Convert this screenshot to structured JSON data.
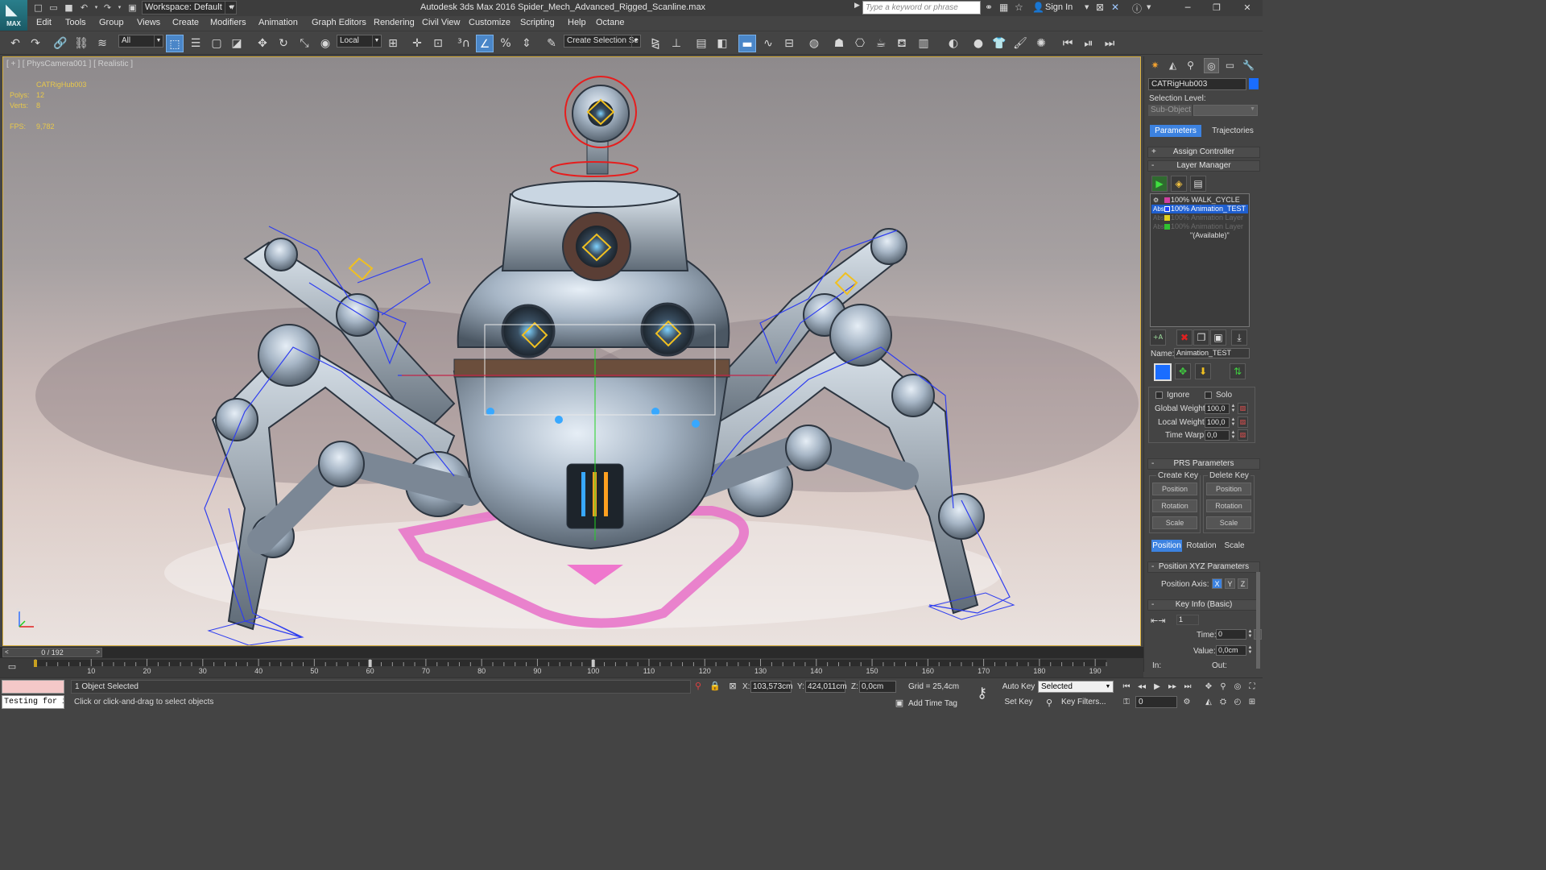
{
  "app": {
    "logo_text": "MAX",
    "title": "Autodesk 3ds Max 2016     Spider_Mech_Advanced_Rigged_Scanline.max",
    "workspace": "Workspace: Default",
    "search_placeholder": "Type a keyword or phrase",
    "sign_in": "Sign In"
  },
  "menu": [
    "Edit",
    "Tools",
    "Group",
    "Views",
    "Create",
    "Modifiers",
    "Animation",
    "Graph Editors",
    "Rendering",
    "Civil View",
    "Customize",
    "Scripting",
    "Help",
    "Octane"
  ],
  "toolbar": {
    "selection_filter": "All",
    "reference_coord": "Local",
    "named_selection": "Create Selection Se"
  },
  "viewport": {
    "label": "[ + ] [ PhysCamera001 ] [ Realistic ]",
    "object_name": "CATRigHub003",
    "polys_label": "Polys:",
    "polys_value": "12",
    "verts_label": "Verts:",
    "verts_value": "8",
    "fps_label": "FPS:",
    "fps_value": "9,782",
    "axis_z": "z",
    "axis_x": "x"
  },
  "command_panel": {
    "object_name": "CATRigHub003",
    "object_color": "#1a6dff",
    "selection_level_label": "Selection Level:",
    "sub_object": "Sub-Object",
    "tabs": [
      "Parameters",
      "Trajectories"
    ],
    "active_tab": "Parameters",
    "rollouts": {
      "assign_controller": "Assign Controller",
      "layer_manager": "Layer Manager",
      "prs": "PRS Parameters",
      "position_xyz": "Position XYZ Parameters",
      "key_info": "Key Info (Basic)"
    },
    "layers": [
      {
        "icon": "⚙",
        "name": "100% WALK_CYCLE",
        "color": "#d040a0",
        "state": "normal"
      },
      {
        "icon": "Abs",
        "name": "100% Animation_TEST",
        "color": "#2040ff",
        "state": "selected"
      },
      {
        "icon": "Abs",
        "name": "100% Animation Layer",
        "color": "#e0d020",
        "state": "dim"
      },
      {
        "icon": "Abs",
        "name": "100% Animation Layer",
        "color": "#30c030",
        "state": "dim"
      }
    ],
    "available": "\"(Available)\"",
    "name_label": "Name:",
    "layer_name": "Animation_TEST",
    "ignore": "Ignore",
    "solo": "Solo",
    "global_weight_label": "Global Weight:",
    "global_weight": "100,0",
    "local_weight_label": "Local Weight:",
    "local_weight": "100,0",
    "time_warp_label": "Time Warp:",
    "time_warp": "0,0",
    "create_key": "Create Key",
    "delete_key": "Delete Key",
    "key_buttons": [
      "Position",
      "Rotation",
      "Scale"
    ],
    "prs_tabs": [
      "Position",
      "Rotation",
      "Scale"
    ],
    "prs_active": "Position",
    "position_axis_label": "Position Axis:",
    "axes": [
      "X",
      "Y",
      "Z"
    ],
    "active_axis": "X",
    "key_index": "1",
    "time_label": "Time:",
    "time_value": "0",
    "lock_label": "L",
    "value_label": "Value:",
    "value_value": "0,0cm",
    "in_label": "In:",
    "out_label": "Out:"
  },
  "timeline": {
    "frame_display": "0 / 192",
    "tick_labels": [
      10,
      20,
      30,
      40,
      50,
      60,
      70,
      80,
      90,
      100,
      110,
      120,
      130,
      140,
      150,
      160,
      170,
      180,
      190
    ],
    "keys": [
      0,
      60,
      100
    ]
  },
  "statusbar": {
    "listener_text": "Testing for i",
    "selection": "1 Object Selected",
    "prompt": "Click or click-and-drag to select objects",
    "x_label": "X:",
    "x_value": "103,573cm",
    "y_label": "Y:",
    "y_value": "424,011cm",
    "z_label": "Z:",
    "z_value": "0,0cm",
    "grid": "Grid = 25,4cm",
    "add_time_tag": "Add Time Tag",
    "auto_key": "Auto Key",
    "set_key": "Set Key",
    "selected": "Selected",
    "key_filters": "Key Filters...",
    "current_frame": "0"
  }
}
